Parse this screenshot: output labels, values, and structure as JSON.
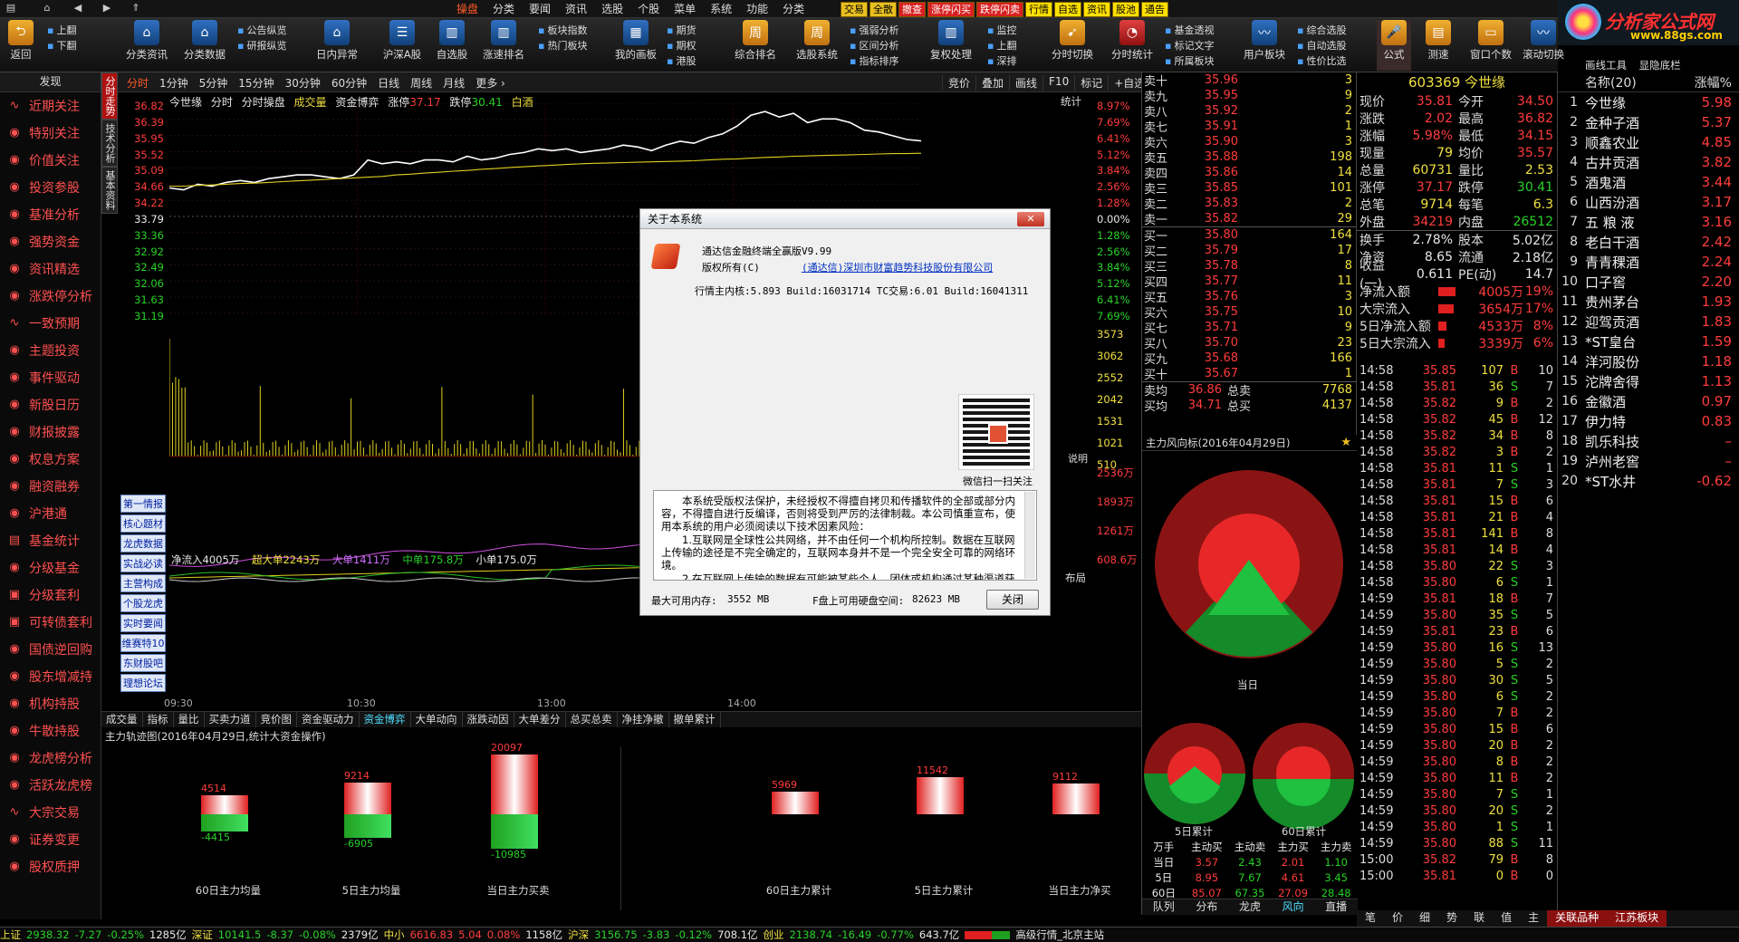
{
  "menubar": {
    "items": [
      "操盘",
      "分类",
      "要闻",
      "资讯",
      "选股",
      "个股",
      "菜单",
      "系统",
      "功能",
      "分类"
    ],
    "active_index": 0,
    "quick": [
      "交易",
      "全散",
      "撤查",
      "涨停闪买",
      "跌停闪卖",
      "行情",
      "自选",
      "资讯",
      "股池",
      "通告"
    ]
  },
  "logo": {
    "title": "分析家公式网",
    "url": "www.88gs.com"
  },
  "toolbar": {
    "back": "返回",
    "up": "上翻",
    "down": "下翻",
    "b1": "分类资讯",
    "b2": "分类数据",
    "s1": [
      "公告纵览",
      "研报纵览"
    ],
    "b3": "日内异常",
    "b4": "沪深A股",
    "b5": "自选股",
    "b6": "涨速排名",
    "s2": [
      "板块指数",
      "热门板块"
    ],
    "b7": "我的画板",
    "s3": [
      "期货",
      "期权",
      "港股"
    ],
    "b8": "综合排名",
    "b9": "选股系统",
    "s4": [
      "强弱分析",
      "区间分析",
      "指标排序"
    ],
    "b10": "复权处理",
    "s5": [
      "监控",
      "上翻",
      "深排"
    ],
    "b11": "分时切换",
    "b12": "分时统计",
    "s6": [
      "基金透视",
      "标记文字",
      "所属板块"
    ],
    "b13": "用户板块",
    "s7": [
      "综合选股",
      "自动选股",
      "性价比选"
    ],
    "b14": "公式",
    "b15": "测速",
    "b16": "窗口个数",
    "b17": "滚动切换",
    "b18": "画线工具",
    "b19": "显隐底栏"
  },
  "tabrow": {
    "faxian": "发现",
    "periods": [
      "分时",
      "1分钟",
      "5分钟",
      "15分钟",
      "30分钟",
      "60分钟",
      "日线",
      "周线",
      "月线",
      "更多 ›"
    ],
    "tools": [
      "竞价",
      "叠加",
      "画线",
      "F10",
      "标记",
      "+自选"
    ]
  },
  "sidebar": {
    "items": [
      "近期关注",
      "特别关注",
      "价值关注",
      "投资参股",
      "基准分析",
      "强势资金",
      "资讯精选",
      "涨跌停分析",
      "一致预期",
      "主题投资",
      "事件驱动",
      "新股日历",
      "财报披露",
      "权息方案",
      "融资融券",
      "沪港通",
      "基金统计",
      "分级基金",
      "分级套利",
      "可转债套利",
      "国债逆回购",
      "股东增减持",
      "机构持股",
      "牛散持股",
      "龙虎榜分析",
      "活跃龙虎榜",
      "大宗交易",
      "证券变更",
      "股权质押"
    ]
  },
  "vtabs": [
    "分时走势",
    "技术分析",
    "基本资料"
  ],
  "chart": {
    "stock_name": "今世缘",
    "label1": "分时",
    "label2": "分时操盘",
    "label3": "成交量",
    "label4": "资金博弈",
    "zt_label": "涨停",
    "zt": "37.17",
    "dt_label": "跌停",
    "dt": "30.41",
    "extra": "白酒",
    "stat": "统计",
    "left_axis": [
      "36.82",
      "36.39",
      "35.95",
      "35.52",
      "35.09",
      "34.66",
      "34.22",
      "33.79",
      "33.36",
      "32.92",
      "32.49",
      "32.06",
      "31.63",
      "31.19"
    ],
    "right_axis": [
      "8.97%",
      "7.69%",
      "6.41%",
      "5.12%",
      "3.84%",
      "2.56%",
      "1.28%",
      "0.00%",
      "1.28%",
      "2.56%",
      "3.84%",
      "5.12%",
      "6.41%",
      "7.69%"
    ],
    "vol_axis": [
      "3573",
      "3062",
      "2552",
      "2042",
      "1531",
      "1021",
      "510"
    ],
    "flow_axis": [
      "2536万",
      "1893万",
      "1261万",
      "608.6万"
    ],
    "time_labels": [
      "09:30",
      "10:30",
      "13:00",
      "14:00"
    ],
    "float_btns": [
      "第一情报",
      "核心题材",
      "龙虎数据",
      "实战必读",
      "主营构成",
      "个股龙虎",
      "实时要闻",
      "维赛特10",
      "东财股吧",
      "理想论坛"
    ],
    "flow_legend": {
      "net_label": "净流入",
      "net": "4005万",
      "chaoda_label": "超大单",
      "chaoda": "2243万",
      "da_label": "大单",
      "da": "1411万",
      "zhong_label": "中单",
      "zhong": "175.8万",
      "xiao_label": "小单",
      "xiao": "175.0万"
    },
    "explain": "说明",
    "layout": "布局"
  },
  "chart_data": {
    "type": "line",
    "title": "",
    "series": [
      {
        "name": "",
        "values": [
          34.55,
          34.5,
          34.65,
          34.6,
          34.7,
          34.75,
          34.7,
          34.8,
          34.85,
          34.9,
          34.9,
          34.85,
          34.8,
          34.9,
          35.3,
          35.2,
          35.25,
          35.2,
          35.3,
          35.3,
          35.25,
          35.4,
          35.3,
          35.35,
          35.45,
          35.5,
          35.6,
          35.55,
          35.6,
          35.5,
          35.55,
          35.6,
          35.7,
          35.65,
          35.55,
          35.7,
          35.8,
          35.75,
          35.9,
          36.0,
          36.2,
          36.5,
          36.6,
          36.45,
          36.55,
          36.3,
          36.4,
          36.4,
          36.3,
          36.1,
          36.05,
          35.95,
          35.85,
          35.81
        ]
      },
      {
        "name": "",
        "values": [
          34.6,
          34.6,
          34.62,
          34.63,
          34.65,
          34.67,
          34.68,
          34.7,
          34.72,
          34.74,
          34.76,
          34.78,
          34.8,
          34.82,
          34.84,
          34.86,
          34.9,
          34.92,
          34.95,
          34.97,
          35.0,
          35.02,
          35.05,
          35.07,
          35.1,
          35.12,
          35.14,
          35.16,
          35.18,
          35.2,
          35.21,
          35.22,
          35.23,
          35.24,
          35.25,
          35.26,
          35.27,
          35.28,
          35.3,
          35.32,
          35.33,
          35.35,
          35.37,
          35.38,
          35.4,
          35.41,
          35.42,
          35.43,
          35.44,
          35.45,
          35.46,
          35.47,
          35.47,
          35.48
        ]
      }
    ],
    "ylim": [
      31.19,
      36.82
    ]
  },
  "bottom_tabs": [
    "成交量",
    "指标",
    "量比",
    "买卖力道",
    "竞价图",
    "资金驱动力",
    "资金博弈",
    "大单动向",
    "涨跌动因",
    "大单差分",
    "总买总卖",
    "净挂净撤",
    "撤单累计"
  ],
  "bottom_tabs_active": 6,
  "flowpanel": {
    "title": "主力轨迹图(2016年04月29日,统计大资金操作)",
    "bars": [
      {
        "name": "60日主力均量",
        "up": "4514",
        "down": "-4415"
      },
      {
        "name": "5日主力均量",
        "up": "9214",
        "down": "-6905"
      },
      {
        "name": "当日主力买卖",
        "up": "20097",
        "down": "-10985"
      },
      {
        "name": "60日主力累计",
        "up": "5969",
        "down": ""
      },
      {
        "name": "5日主力累计",
        "up": "11542",
        "down": ""
      },
      {
        "name": "当日主力净买",
        "up": "9112",
        "down": ""
      }
    ]
  },
  "orderbook": {
    "sells": [
      {
        "l": "卖十",
        "p": "35.96",
        "v": "3"
      },
      {
        "l": "卖九",
        "p": "35.95",
        "v": "9"
      },
      {
        "l": "卖八",
        "p": "35.92",
        "v": "2"
      },
      {
        "l": "卖七",
        "p": "35.91",
        "v": "1"
      },
      {
        "l": "卖六",
        "p": "35.90",
        "v": "3"
      },
      {
        "l": "卖五",
        "p": "35.88",
        "v": "198"
      },
      {
        "l": "卖四",
        "p": "35.86",
        "v": "14"
      },
      {
        "l": "卖三",
        "p": "35.85",
        "v": "101"
      },
      {
        "l": "卖二",
        "p": "35.83",
        "v": "2"
      },
      {
        "l": "卖一",
        "p": "35.82",
        "v": "29"
      }
    ],
    "buys": [
      {
        "l": "买一",
        "p": "35.80",
        "v": "164"
      },
      {
        "l": "买二",
        "p": "35.79",
        "v": "17"
      },
      {
        "l": "买三",
        "p": "35.78",
        "v": "8"
      },
      {
        "l": "买四",
        "p": "35.77",
        "v": "11"
      },
      {
        "l": "买五",
        "p": "35.76",
        "v": "3"
      },
      {
        "l": "买六",
        "p": "35.75",
        "v": "10"
      },
      {
        "l": "买七",
        "p": "35.71",
        "v": "9"
      },
      {
        "l": "买八",
        "p": "35.70",
        "v": "23"
      },
      {
        "l": "买九",
        "p": "35.68",
        "v": "166"
      },
      {
        "l": "买十",
        "p": "35.67",
        "v": "1"
      }
    ],
    "summary": [
      {
        "l": "卖均",
        "p": "36.86",
        "l2": "总卖",
        "v": "7768"
      },
      {
        "l": "买均",
        "p": "34.71",
        "l2": "总买",
        "v": "4137"
      }
    ]
  },
  "stockinfo": {
    "code_name": "603369 今世缘",
    "rows": [
      {
        "l": "现价",
        "v": "35.81",
        "l2": "今开",
        "v2": "34.50"
      },
      {
        "l": "涨跌",
        "v": "2.02",
        "l2": "最高",
        "v2": "36.82"
      },
      {
        "l": "涨幅",
        "v": "5.98%",
        "l2": "最低",
        "v2": "34.15"
      },
      {
        "l": "现量",
        "v": "79",
        "l2": "均价",
        "v2": "35.57"
      },
      {
        "l": "总量",
        "v": "60731",
        "l2": "量比",
        "v2": "2.53"
      },
      {
        "l": "涨停",
        "v": "37.17",
        "l2": "跌停",
        "v2": "30.41"
      },
      {
        "l": "总笔",
        "v": "9714",
        "l2": "每笔",
        "v2": "6.3"
      },
      {
        "l": "外盘",
        "v": "34219",
        "l2": "内盘",
        "v2": "26512"
      },
      {
        "l": "换手",
        "v": "2.78%",
        "l2": "股本",
        "v2": "5.02亿"
      },
      {
        "l": "净资",
        "v": "8.65",
        "l2": "流通",
        "v2": "2.18亿"
      },
      {
        "l": "收益(一)",
        "v": "0.611",
        "l2": "PE(动)",
        "v2": "14.7"
      }
    ],
    "flows": [
      {
        "l": "净流入额",
        "v": "4005万",
        "p": "19%",
        "fill": 0.62
      },
      {
        "l": "大宗流入",
        "v": "3654万",
        "p": "17%",
        "fill": 0.56
      },
      {
        "l": "5日净流入额",
        "v": "4533万",
        "p": "8%",
        "fill": 0.3
      },
      {
        "l": "5日大宗流入",
        "v": "3339万",
        "p": "6%",
        "fill": 0.22
      }
    ]
  },
  "ticks": [
    {
      "t": "14:58",
      "p": "35.85",
      "v": "107",
      "s": "B",
      "n": "10"
    },
    {
      "t": "14:58",
      "p": "35.81",
      "v": "36",
      "s": "S",
      "n": "7"
    },
    {
      "t": "14:58",
      "p": "35.82",
      "v": "9",
      "s": "B",
      "n": "2"
    },
    {
      "t": "14:58",
      "p": "35.82",
      "v": "45",
      "s": "B",
      "n": "12"
    },
    {
      "t": "14:58",
      "p": "35.82",
      "v": "34",
      "s": "B",
      "n": "8"
    },
    {
      "t": "14:58",
      "p": "35.82",
      "v": "3",
      "s": "B",
      "n": "2"
    },
    {
      "t": "14:58",
      "p": "35.81",
      "v": "11",
      "s": "S",
      "n": "1"
    },
    {
      "t": "14:58",
      "p": "35.81",
      "v": "7",
      "s": "S",
      "n": "3"
    },
    {
      "t": "14:58",
      "p": "35.81",
      "v": "15",
      "s": "B",
      "n": "6"
    },
    {
      "t": "14:58",
      "p": "35.81",
      "v": "21",
      "s": "B",
      "n": "4"
    },
    {
      "t": "14:58",
      "p": "35.81",
      "v": "141",
      "s": "B",
      "n": "8"
    },
    {
      "t": "14:58",
      "p": "35.81",
      "v": "14",
      "s": "B",
      "n": "4"
    },
    {
      "t": "14:58",
      "p": "35.80",
      "v": "22",
      "s": "S",
      "n": "3"
    },
    {
      "t": "14:58",
      "p": "35.80",
      "v": "6",
      "s": "S",
      "n": "1"
    },
    {
      "t": "14:59",
      "p": "35.81",
      "v": "18",
      "s": "B",
      "n": "7"
    },
    {
      "t": "14:59",
      "p": "35.80",
      "v": "35",
      "s": "S",
      "n": "5"
    },
    {
      "t": "14:59",
      "p": "35.81",
      "v": "23",
      "s": "B",
      "n": "6"
    },
    {
      "t": "14:59",
      "p": "35.80",
      "v": "16",
      "s": "S",
      "n": "13"
    },
    {
      "t": "14:59",
      "p": "35.80",
      "v": "5",
      "s": "S",
      "n": "2"
    },
    {
      "t": "14:59",
      "p": "35.80",
      "v": "30",
      "s": "S",
      "n": "5"
    },
    {
      "t": "14:59",
      "p": "35.80",
      "v": "6",
      "s": "S",
      "n": "2"
    },
    {
      "t": "14:59",
      "p": "35.80",
      "v": "7",
      "s": "B",
      "n": "2"
    },
    {
      "t": "14:59",
      "p": "35.80",
      "v": "15",
      "s": "B",
      "n": "6"
    },
    {
      "t": "14:59",
      "p": "35.80",
      "v": "20",
      "s": "B",
      "n": "2"
    },
    {
      "t": "14:59",
      "p": "35.80",
      "v": "8",
      "s": "B",
      "n": "2"
    },
    {
      "t": "14:59",
      "p": "35.80",
      "v": "11",
      "s": "B",
      "n": "2"
    },
    {
      "t": "14:59",
      "p": "35.80",
      "v": "7",
      "s": "S",
      "n": "1"
    },
    {
      "t": "14:59",
      "p": "35.80",
      "v": "20",
      "s": "S",
      "n": "2"
    },
    {
      "t": "14:59",
      "p": "35.80",
      "v": "1",
      "s": "S",
      "n": "1"
    },
    {
      "t": "14:59",
      "p": "35.80",
      "v": "88",
      "s": "S",
      "n": "11"
    },
    {
      "t": "15:00",
      "p": "35.82",
      "v": "79",
      "s": "B",
      "n": "8"
    },
    {
      "t": "15:00",
      "p": "35.81",
      "v": "0",
      "s": "B",
      "n": "0"
    }
  ],
  "rank": {
    "hdr_name": "名称(20)",
    "hdr_pct": "涨幅%",
    "items": [
      {
        "n": "今世缘",
        "p": "5.98"
      },
      {
        "n": "金种子酒",
        "p": "5.37"
      },
      {
        "n": "顺鑫农业",
        "p": "4.85"
      },
      {
        "n": "古井贡酒",
        "p": "3.82"
      },
      {
        "n": "酒鬼酒",
        "p": "3.44"
      },
      {
        "n": "山西汾酒",
        "p": "3.17"
      },
      {
        "n": "五 粮 液",
        "p": "3.16"
      },
      {
        "n": "老白干酒",
        "p": "2.42"
      },
      {
        "n": "青青稞酒",
        "p": "2.24"
      },
      {
        "n": "口子窖",
        "p": "2.20"
      },
      {
        "n": "贵州茅台",
        "p": "1.93"
      },
      {
        "n": "迎驾贡酒",
        "p": "1.83"
      },
      {
        "n": "*ST皇台",
        "p": "1.59"
      },
      {
        "n": "洋河股份",
        "p": "1.18"
      },
      {
        "n": "沱牌舍得",
        "p": "1.13"
      },
      {
        "n": "金徽酒",
        "p": "0.97"
      },
      {
        "n": "伊力特",
        "p": "0.83"
      },
      {
        "n": "凯乐科技",
        "p": "–"
      },
      {
        "n": "泸州老窖",
        "p": "–"
      },
      {
        "n": "*ST水井",
        "p": "-0.62"
      }
    ]
  },
  "fengxiang": {
    "title": "主力风向标(2016年04月29日)",
    "today": "当日",
    "d5": "5日累计",
    "d60": "60日累计",
    "table_hdr": [
      "万手",
      "主动买",
      "主动卖",
      "主力买",
      "主力卖"
    ],
    "table_rows": [
      {
        "l": "当日",
        "a": "3.57",
        "b": "2.43",
        "c": "2.01",
        "d": "1.10"
      },
      {
        "l": "5日",
        "a": "8.95",
        "b": "7.67",
        "c": "4.61",
        "d": "3.45"
      },
      {
        "l": "60日",
        "a": "85.07",
        "b": "67.35",
        "c": "27.09",
        "d": "28.48"
      }
    ],
    "tabs": [
      "队列",
      "分布",
      "龙虎",
      "风向",
      "直播"
    ],
    "active_tab": 3
  },
  "rank_tabs": [
    "笔",
    "价",
    "细",
    "势",
    "联",
    "值",
    "主"
  ],
  "rank_tabs_extra": [
    "关联品种",
    "江苏板块"
  ],
  "statusbar": {
    "sh_label": "上证",
    "sh": "2938.32",
    "sh_chg": "-7.27",
    "sh_pct": "-0.25%",
    "sh_amt": "1285亿",
    "sz_label": "深证",
    "sz": "10141.5",
    "sz_chg": "-8.37",
    "sz_pct": "-0.08%",
    "sz_amt": "2379亿",
    "zx_label": "中小",
    "zx": "6616.83",
    "zx_chg": "5.04",
    "zx_pct": "0.08%",
    "zx_amt": "1158亿",
    "hs_label": "沪深",
    "hs": "3156.75",
    "hs_chg": "-3.83",
    "hs_pct": "-0.12%",
    "hs_amt": "708.1亿",
    "cy_label": "创业",
    "cy": "2138.74",
    "cy_chg": "-16.49",
    "cy_pct": "-0.77%",
    "cy_amt": "643.7亿",
    "server": "高级行情_北京主站"
  },
  "dialog": {
    "title": "关于本系统",
    "product": "通达信金融终端全赢版V9.99",
    "copyright_label": "版权所有(C)",
    "company": "(通达信)深圳市财富趋势科技股份有限公司",
    "version": "行情主内核:5.893 Build:16031714 TC交易:6.01 Build:16041311",
    "qr_caption": "微信扫一扫关注",
    "legal": [
      "本系统受版权法保护，未经授权不得擅自拷贝和传播软件的全部或部分内容，不得擅自进行反编译，否则将受到严厉的法律制裁。本公司慎重宣布，使用本系统的用户必须阅读以下技术因素风险：",
      "1.互联网是全球性公共网络，并不由任何一个机构所控制。数据在互联网上传输的途径是不完全确定的，互联网本身并不是一个完全安全可靠的网络环境。",
      "2.在互联网上传输的数据有可能被某些个人、团体或机构通过某种渠道获"
    ],
    "mem_label": "最大可用内存:",
    "mem": "3552 MB",
    "disk_label": "F盘上可用硬盘空间:",
    "disk": "82623 MB",
    "close_btn": "关闭"
  }
}
